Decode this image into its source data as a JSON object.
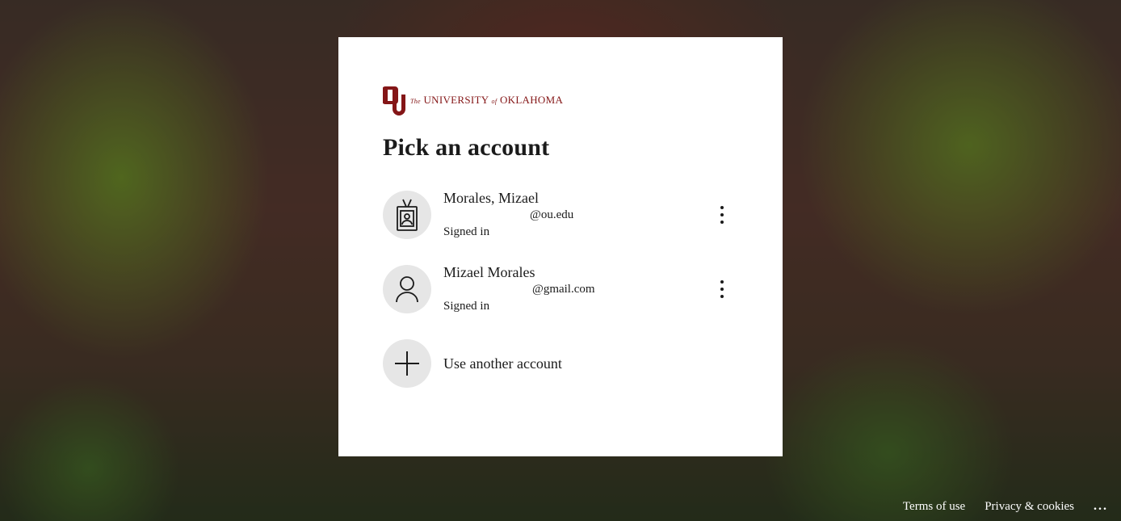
{
  "logo": {
    "prefix": "The",
    "name_a": "UNIVERSITY",
    "connector": "of",
    "name_b": "OKLAHOMA",
    "brand_color": "#841617"
  },
  "title": "Pick an account",
  "accounts": [
    {
      "name": "Morales, Mizael",
      "email": "@ou.edu",
      "status": "Signed in",
      "icon": "badge-icon"
    },
    {
      "name": "Mizael Morales",
      "email": "@gmail.com",
      "status": "Signed in",
      "icon": "person-icon"
    }
  ],
  "use_another": {
    "label": "Use another account",
    "icon": "plus-icon"
  },
  "footer": {
    "terms": "Terms of use",
    "privacy": "Privacy & cookies",
    "more": "..."
  }
}
